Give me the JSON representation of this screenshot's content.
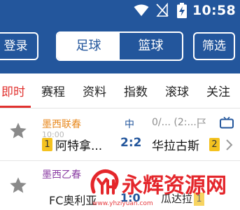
{
  "status_bar": {
    "time": "10:58",
    "icons": [
      "wifi-icon",
      "signal-off-icon",
      "battery-charging-icon"
    ]
  },
  "toolbar": {
    "login_label": "登录",
    "segment": {
      "active": "足球",
      "inactive": "篮球"
    },
    "filter_label": "筛选"
  },
  "tabs": {
    "items": [
      {
        "label": "即时",
        "active": true
      },
      {
        "label": "赛程",
        "active": false
      },
      {
        "label": "资料",
        "active": false
      },
      {
        "label": "指数",
        "active": false
      },
      {
        "label": "滚球",
        "active": false
      },
      {
        "label": "关注",
        "active": false
      }
    ]
  },
  "matches": [
    {
      "league": "墨西联春",
      "league_color": "#e8891f",
      "time": "10:00",
      "status": "中",
      "odds": "0/...  (2:...",
      "home_rank": "1",
      "home_team": "阿特拿...",
      "score": "2:2",
      "away_team": "华拉古斯",
      "away_rank": "2"
    },
    {
      "league": "墨西乙春",
      "league_color": "#8b3ea3",
      "home_team": "FC奥利亚",
      "score": "1:0",
      "away_team": "瓜达拉",
      "away_rank": "1"
    }
  ],
  "watermark": {
    "text": "永辉资源网",
    "sub": "www.yhziyuan.com"
  },
  "colors": {
    "primary": "#23569c",
    "accent": "#e1322f",
    "rank_badge": "#f4c21f"
  }
}
